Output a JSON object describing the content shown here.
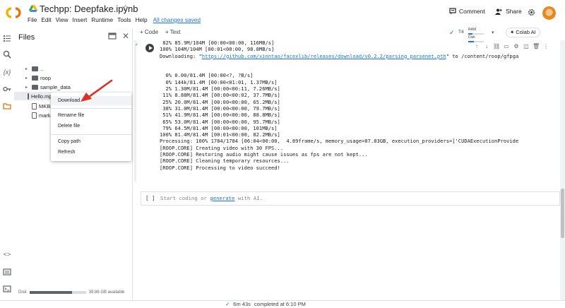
{
  "header": {
    "title": "Techpp: Deepfake.ipynb",
    "star_icon": "star-outline-icon",
    "menu": [
      "File",
      "Edit",
      "View",
      "Insert",
      "Runtime",
      "Tools",
      "Help"
    ],
    "saved_status": "All changes saved",
    "comment_label": "Comment",
    "share_label": "Share",
    "settings_icon": "gear-icon"
  },
  "files_panel": {
    "title": "Files",
    "tree": [
      {
        "name": "..",
        "type": "folder"
      },
      {
        "name": "roop",
        "type": "folder"
      },
      {
        "name": "sample_data",
        "type": "folder"
      },
      {
        "name": "Hello.mp4",
        "type": "file"
      },
      {
        "name": "MKBH",
        "type": "file"
      },
      {
        "name": "mark.j",
        "type": "file"
      }
    ],
    "disk_label": "Disk",
    "disk_available": "39.86 GB available",
    "disk_used_fraction": 0.75
  },
  "context_menu": {
    "items": [
      "Download",
      "Rename file",
      "Delete file",
      "Copy path",
      "Refresh"
    ]
  },
  "toolbar": {
    "code_label": "+ Code",
    "text_label": "+ Text",
    "runtime": "T4",
    "ram_label": "RAM",
    "disk_label": "Disk",
    "ram_fraction": 0.25,
    "disk_fraction": 0.35,
    "colab_ai_label": "Colab AI"
  },
  "cell_output": {
    "lines": [
      {
        "text": " 82% 85.9M/104M [00:00<00:00, 116MB/s]"
      },
      {
        "text": "100% 104M/104M [00:01<00:00, 98.8MB/s]"
      },
      {
        "prefix": "Downloading: \"",
        "link": "https://github.com/xinntao/facexlib/releases/download/v0.2.2/parsing_parsenet.pth",
        "suffix": "\" to /content/roop/gfpga"
      },
      {
        "text": ""
      },
      {
        "text": ""
      },
      {
        "text": "  0% 0.00/81.4M [00:00<?, ?B/s]"
      },
      {
        "text": "  0% 144k/81.4M [00:00<01:01, 1.37MB/s]"
      },
      {
        "text": "  2% 1.30M/81.4M [00:00<00:11, 7.26MB/s]"
      },
      {
        "text": " 11% 8.88M/81.4M [00:00<00:02, 37.7MB/s]"
      },
      {
        "text": " 25% 20.0M/81.4M [00:00<00:00, 65.2MB/s]"
      },
      {
        "text": " 38% 31.0M/81.4M [00:00<00:00, 79.7MB/s]"
      },
      {
        "text": " 51% 41.9M/81.4M [00:00<00:00, 88.8MB/s]"
      },
      {
        "text": " 65% 53.0M/81.4M [00:00<00:00, 95.7MB/s]"
      },
      {
        "text": " 79% 64.5M/81.4M [00:00<00:00, 101MB/s]"
      },
      {
        "text": "100% 81.4M/81.4M [00:01<00:00, 82.2MB/s]"
      },
      {
        "text": "Processing: 100% 1784/1784 [06:04<00:00,  4.89frame/s, memory_usage=07.03GB, execution_providers=['CUDAExecutionProvide"
      },
      {
        "text": "[ROOP.CORE] Creating video with 30 FPS..."
      },
      {
        "text": "[ROOP.CORE] Restoring audio might cause issues as fps are not kept..."
      },
      {
        "text": "[ROOP.CORE] Cleaning temporary resources..."
      },
      {
        "text": "[ROOP.CORE] Processing to video succeed!"
      }
    ]
  },
  "empty_cell": {
    "brackets": "[ ]",
    "placeholder_prefix": "Start coding or ",
    "placeholder_link": "generate",
    "placeholder_suffix": " with AI."
  },
  "status_bar": {
    "duration": "6m 43s",
    "completed": "completed at 6:10 PM"
  },
  "colors": {
    "accent": "#1a73e8",
    "success": "#188038",
    "logo_orange": "#f9ab00",
    "arrow_red": "#d93025"
  }
}
